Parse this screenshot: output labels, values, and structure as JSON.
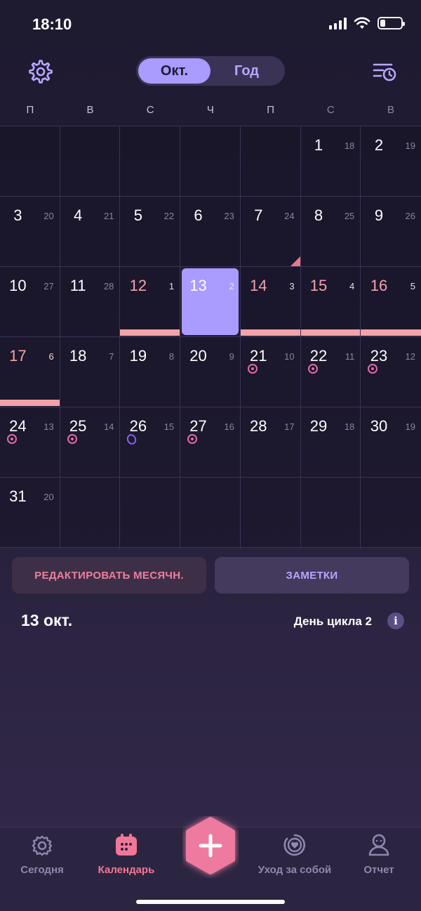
{
  "status_bar": {
    "time": "18:10"
  },
  "header": {
    "settings_icon": "gear-icon",
    "segments": [
      {
        "label": "Окт.",
        "active": true
      },
      {
        "label": "Год",
        "active": false
      }
    ],
    "history_icon": "list-clock-icon"
  },
  "weekdays": [
    "П",
    "В",
    "С",
    "Ч",
    "П",
    "С",
    "В"
  ],
  "calendar": {
    "cells": [
      {
        "day": "",
        "cycle": ""
      },
      {
        "day": "",
        "cycle": ""
      },
      {
        "day": "",
        "cycle": ""
      },
      {
        "day": "",
        "cycle": ""
      },
      {
        "day": "",
        "cycle": ""
      },
      {
        "day": "1",
        "cycle": "18"
      },
      {
        "day": "2",
        "cycle": "19"
      },
      {
        "day": "3",
        "cycle": "20"
      },
      {
        "day": "4",
        "cycle": "21"
      },
      {
        "day": "5",
        "cycle": "22"
      },
      {
        "day": "6",
        "cycle": "23"
      },
      {
        "day": "7",
        "cycle": "24"
      },
      {
        "day": "8",
        "cycle": "25"
      },
      {
        "day": "9",
        "cycle": "26"
      },
      {
        "day": "10",
        "cycle": "27"
      },
      {
        "day": "11",
        "cycle": "28"
      },
      {
        "day": "12",
        "cycle": "1"
      },
      {
        "day": "13",
        "cycle": "2"
      },
      {
        "day": "14",
        "cycle": "3"
      },
      {
        "day": "15",
        "cycle": "4"
      },
      {
        "day": "16",
        "cycle": "5"
      },
      {
        "day": "17",
        "cycle": "6"
      },
      {
        "day": "18",
        "cycle": "7"
      },
      {
        "day": "19",
        "cycle": "8"
      },
      {
        "day": "20",
        "cycle": "9"
      },
      {
        "day": "21",
        "cycle": "10"
      },
      {
        "day": "22",
        "cycle": "11"
      },
      {
        "day": "23",
        "cycle": "12"
      },
      {
        "day": "24",
        "cycle": "13"
      },
      {
        "day": "25",
        "cycle": "14"
      },
      {
        "day": "26",
        "cycle": "15"
      },
      {
        "day": "27",
        "cycle": "16"
      },
      {
        "day": "28",
        "cycle": "17"
      },
      {
        "day": "29",
        "cycle": "18"
      },
      {
        "day": "30",
        "cycle": "19"
      },
      {
        "day": "31",
        "cycle": "20"
      },
      {
        "day": "",
        "cycle": ""
      },
      {
        "day": "",
        "cycle": ""
      },
      {
        "day": "",
        "cycle": ""
      },
      {
        "day": "",
        "cycle": ""
      },
      {
        "day": "",
        "cycle": ""
      },
      {
        "day": "",
        "cycle": ""
      }
    ],
    "selected_day": "13",
    "period_days": [
      "12",
      "13",
      "14",
      "15",
      "16",
      "17"
    ],
    "ovulation_days": [
      "21",
      "22",
      "23",
      "24",
      "25",
      "27"
    ],
    "ovulation_peak_day": "26",
    "marker_day": "7",
    "colors": {
      "selected": "#a99bff",
      "period": "#f2a3a8",
      "ovulation": "#e369a9",
      "accent": "#f07896"
    }
  },
  "actions": {
    "edit_label": "РЕДАКТИРОВАТЬ МЕСЯЧН.",
    "notes_label": "ЗАМЕТКИ"
  },
  "day_info": {
    "date": "13 окт.",
    "cycle_day": "День цикла 2",
    "info_icon": "i"
  },
  "tabbar": {
    "tabs": [
      {
        "label": "Сегодня",
        "icon": "flower-icon",
        "active": false
      },
      {
        "label": "Календарь",
        "icon": "calendar-icon",
        "active": true
      },
      {
        "label": "Уход за собой",
        "icon": "heart-circle-icon",
        "active": false
      },
      {
        "label": "Отчет",
        "icon": "person-icon",
        "active": false
      }
    ],
    "fab_icon": "plus-icon"
  }
}
